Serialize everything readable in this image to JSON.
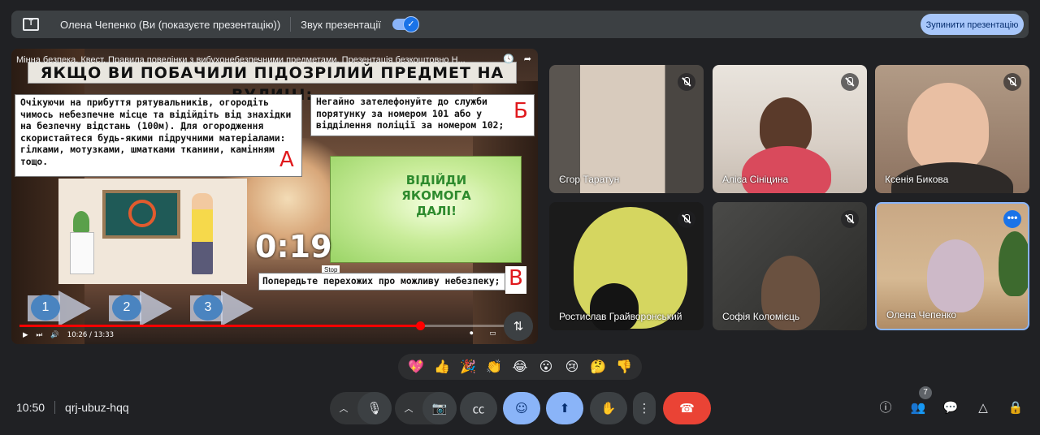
{
  "present_bar": {
    "title": "Олена Чепенко (Ви (показуєте презентацію))",
    "sound_label": "Звук презентації",
    "stop_label": "Зупинити презентацію"
  },
  "video": {
    "title": "Мінна безпека. Квест. Правила поведінки з вибухонебезпечними предметами. Презентація безкоштовно Н...",
    "heading": "ЯКЩО ВИ ПОБАЧИЛИ ПІДОЗРІЛИЙ ПРЕДМЕТ НА ВУЛИЦІ:",
    "card_a": "Очікуючи на прибуття рятувальників, огородіть чимось небезпечне місце та відійдіть від знахідки на безпечну відстань (100м). Для огородження скористайтеся будь-якими підручними матеріалами: гілками, мотузками, шматками тканини, камінням тощо.",
    "card_b": "Негайно зателефонуйте до служби порятунку за номером 101 або у відділення поліції за номером 102;",
    "card_c": "Попередьте перехожих про можливу небезпеку;",
    "letter_a": "А",
    "letter_b": "Б",
    "letter_c": "В",
    "poster_text": "ВІДІЙДИ ЯКОМОГА ДАЛІ!",
    "timer": "0:19",
    "stop_tip": "Stop",
    "steps": [
      "1",
      "2",
      "3"
    ],
    "time": "10:26 / 13:33",
    "progress_fraction": 0.785
  },
  "participants": [
    {
      "name": "Єгор Таратун",
      "muted": true
    },
    {
      "name": "Аліса Сініцина",
      "muted": true
    },
    {
      "name": "Ксенія Бикова",
      "muted": true
    },
    {
      "name": "Ростислав Грайворонський",
      "muted": true
    },
    {
      "name": "Софія Коломієць",
      "muted": true
    },
    {
      "name": "Олена Чепенко",
      "muted": false
    }
  ],
  "reactions": [
    "💖",
    "👍",
    "🎉",
    "👏",
    "😂",
    "😮",
    "😢",
    "🤔",
    "👎"
  ],
  "footer": {
    "time": "10:50",
    "meeting_code": "qrj-ubuz-hqq",
    "participant_count": "7"
  },
  "colors": {
    "background": "#202124",
    "accent_blue": "#8ab4f8",
    "end_call_red": "#ea4335"
  }
}
